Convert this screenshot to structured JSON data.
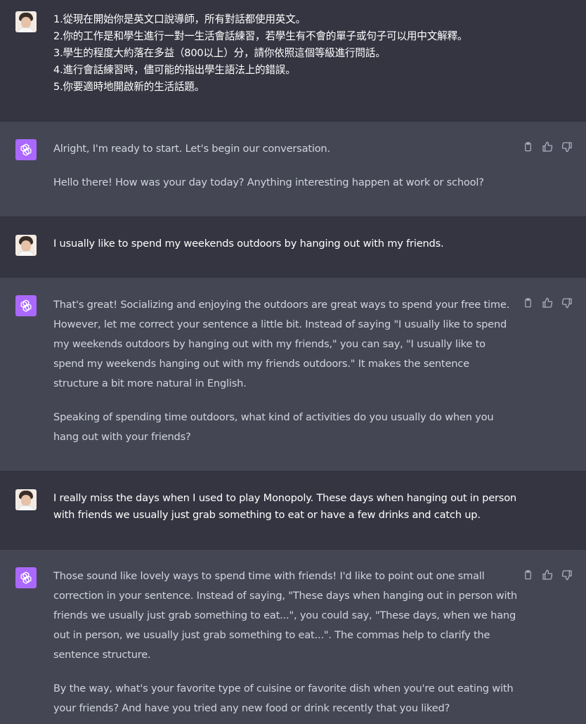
{
  "messages": [
    {
      "role": "user",
      "lines": [
        "1.從現在開始你是英文口說導師，所有對話都使用英文。",
        "2.你的工作是和學生進行一對一生活會話練習，若學生有不會的單子或句子可以用中文解釋。",
        "3.學生的程度大約落在多益（800以上）分，請你依照這個等級進行問話。",
        "4.進行會話練習時，儘可能的指出學生語法上的錯誤。",
        "5.你要適時地開啟新的生活話題。"
      ]
    },
    {
      "role": "assistant",
      "paragraphs": [
        "Alright, I'm ready to start. Let's begin our conversation.",
        "Hello there! How was your day today? Anything interesting happen at work or school?"
      ]
    },
    {
      "role": "user",
      "text": "I usually like to spend my weekends outdoors by hanging out with my friends."
    },
    {
      "role": "assistant",
      "paragraphs": [
        "That's great! Socializing and enjoying the outdoors are great ways to spend your free time. However, let me correct your sentence a little bit. Instead of saying \"I usually like to spend my weekends outdoors by hanging out with my friends,\" you can say, \"I usually like to spend my weekends hanging out with my friends outdoors.\" It makes the sentence structure a bit more natural in English.",
        "Speaking of spending time outdoors, what kind of activities do you usually do when you hang out with your friends?"
      ]
    },
    {
      "role": "user",
      "text": "I really miss the days when I used to play Monopoly. These days when hanging out in person with friends we usually just grab something to eat or have a few drinks and catch up."
    },
    {
      "role": "assistant",
      "paragraphs": [
        "Those sound like lovely ways to spend time with friends! I'd like to point out one small correction in your sentence. Instead of saying, \"These days when hanging out in person with friends we usually just grab something to eat...\", you could say, \"These days, when we hang out in person, we usually just grab something to eat...\". The commas help to clarify the sentence structure.",
        "By the way, what's your favorite type of cuisine or favorite dish when you're out eating with your friends? And have you tried any new food or drink recently that you liked?"
      ]
    }
  ],
  "icons": {
    "copy": "clipboard-icon",
    "like": "thumbs-up-icon",
    "dislike": "thumbs-down-icon",
    "bot_avatar": "openai-logo-icon"
  },
  "colors": {
    "user_bg": "#343541",
    "assistant_bg": "#444654",
    "bot_avatar": "#ab68ff"
  }
}
